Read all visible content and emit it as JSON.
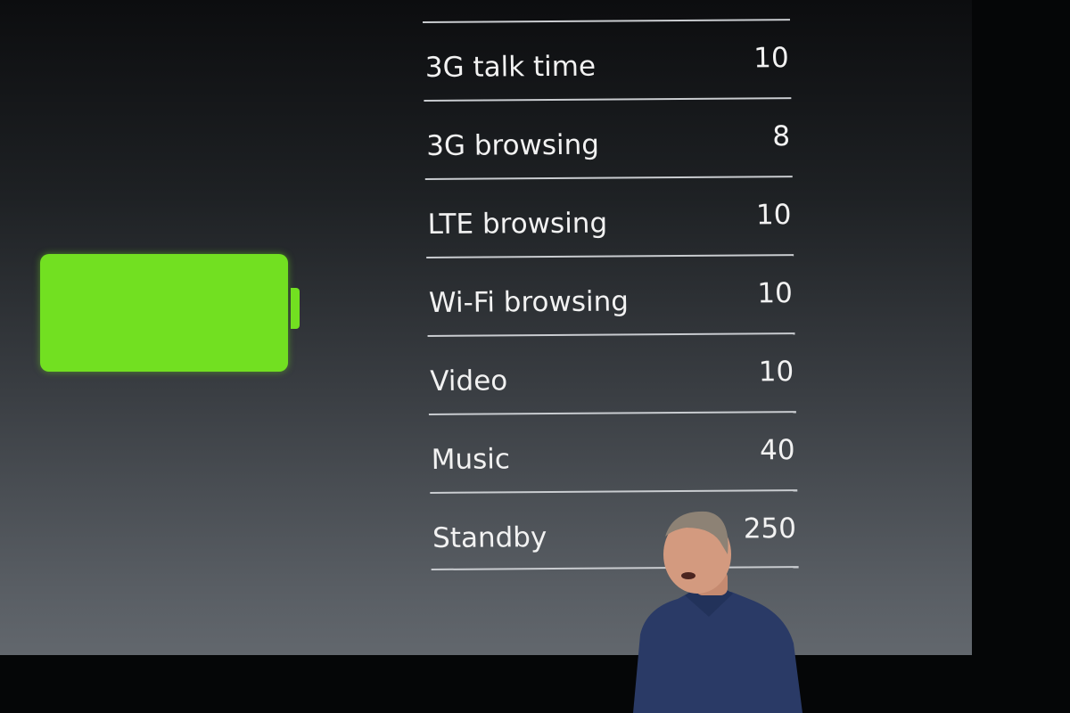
{
  "slide": {
    "battery_icon": "battery-full-icon",
    "battery_color": "#72e021",
    "battery_level_percent": 100,
    "rows": [
      {
        "label": "3G talk time",
        "value": "10"
      },
      {
        "label": "3G browsing",
        "value": "8"
      },
      {
        "label": "LTE browsing",
        "value": "10"
      },
      {
        "label": "Wi-Fi browsing",
        "value": "10"
      },
      {
        "label": "Video",
        "value": "10"
      },
      {
        "label": "Music",
        "value": "40"
      },
      {
        "label": "Standby",
        "value": "250"
      }
    ]
  }
}
